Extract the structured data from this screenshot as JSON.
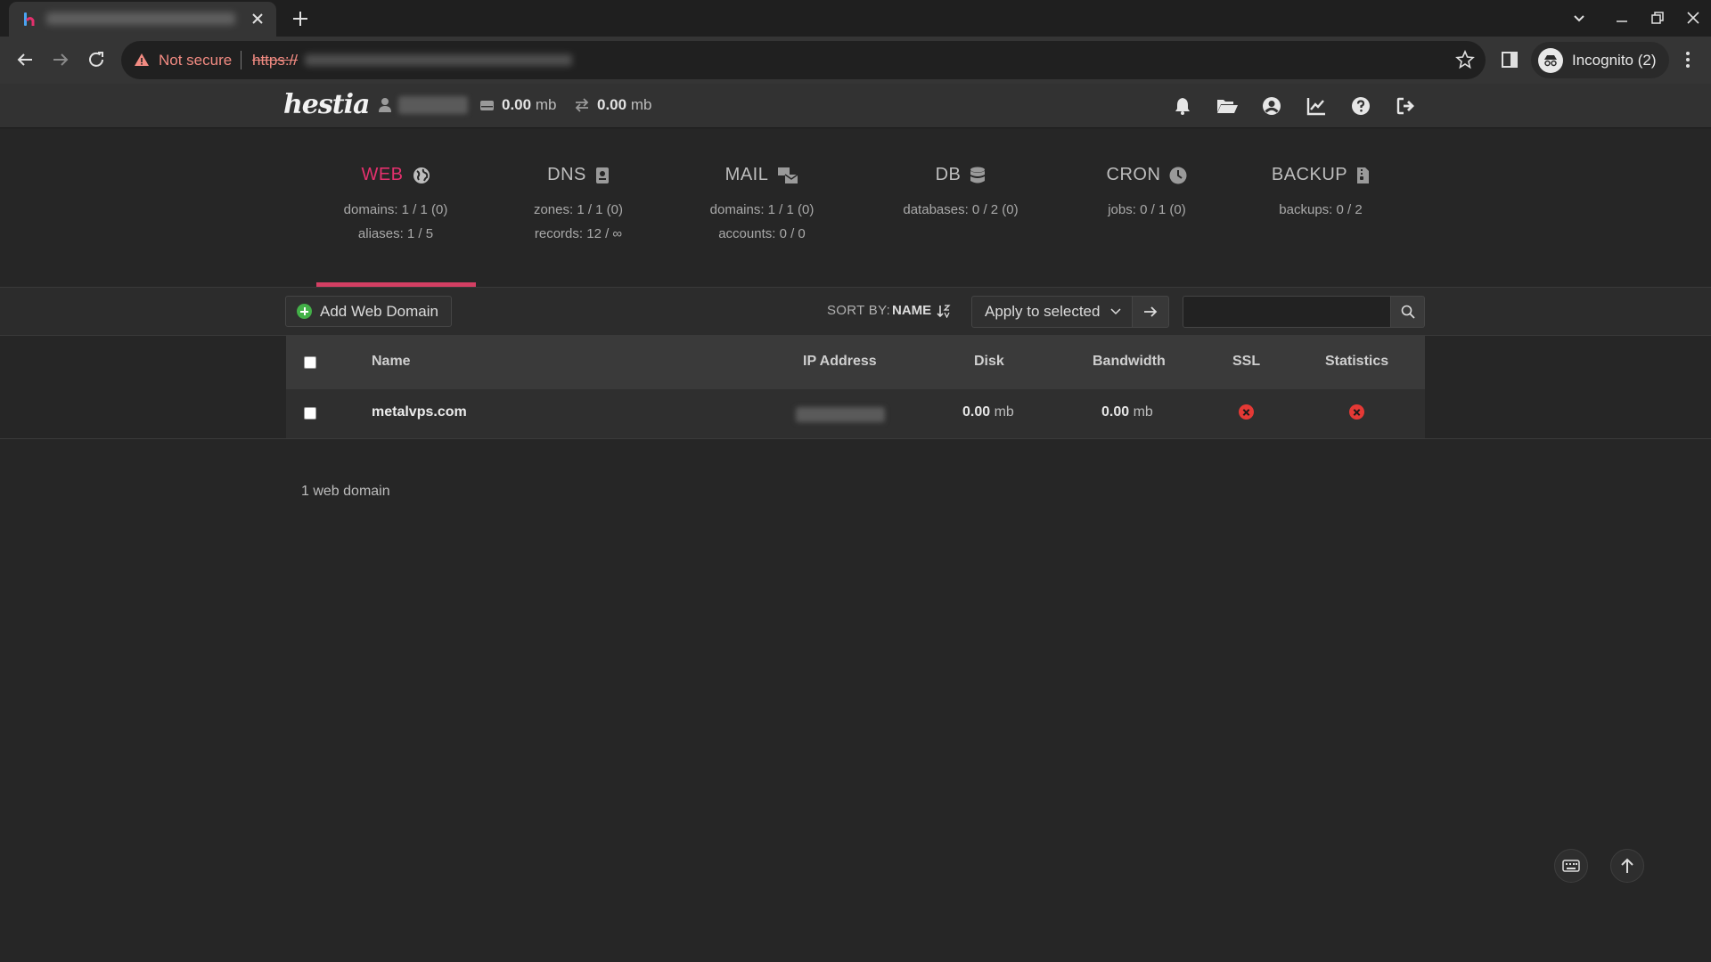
{
  "browser": {
    "not_secure": "Not secure",
    "url_scheme": "https://",
    "incognito": "Incognito (2)"
  },
  "topbar": {
    "logo": "hestia",
    "disk_value": "0.00",
    "disk_unit": "mb",
    "bandwidth_value": "0.00",
    "bandwidth_unit": "mb"
  },
  "sections": [
    {
      "key": "web",
      "title": "WEB",
      "icon": "globe-icon",
      "line1": "domains: 1 / 1 (0)",
      "line2": "aliases: 1 / 5"
    },
    {
      "key": "dns",
      "title": "DNS",
      "icon": "book-icon",
      "line1": "zones: 1 / 1 (0)",
      "line2": "records: 12 / ∞"
    },
    {
      "key": "mail",
      "title": "MAIL",
      "icon": "mail-bulk-icon",
      "line1": "domains: 1 / 1 (0)",
      "line2": "accounts: 0 / 0"
    },
    {
      "key": "db",
      "title": "DB",
      "icon": "database-icon",
      "line1": "databases: 0 / 2 (0)",
      "line2": ""
    },
    {
      "key": "cron",
      "title": "CRON",
      "icon": "clock-icon",
      "line1": "jobs: 0 / 1 (0)",
      "line2": ""
    },
    {
      "key": "backup",
      "title": "BACKUP",
      "icon": "file-archive-icon",
      "line1": "backups: 0 / 2",
      "line2": ""
    }
  ],
  "actions": {
    "add_label": "Add Web Domain",
    "sort_by_label": "SORT BY:",
    "sort_value": "NAME",
    "apply_label": "Apply to selected",
    "search_value": ""
  },
  "table": {
    "columns": [
      "Name",
      "IP Address",
      "Disk",
      "Bandwidth",
      "SSL",
      "Statistics"
    ],
    "rows": [
      {
        "name": "metalvps.com",
        "disk_value": "0.00",
        "disk_unit": "mb",
        "bandwidth_value": "0.00",
        "bandwidth_unit": "mb"
      }
    ]
  },
  "footer": {
    "count": "1 web domain"
  },
  "colors": {
    "accent": "#e4306d",
    "add_green": "#43b048",
    "status_red": "#e53935"
  }
}
